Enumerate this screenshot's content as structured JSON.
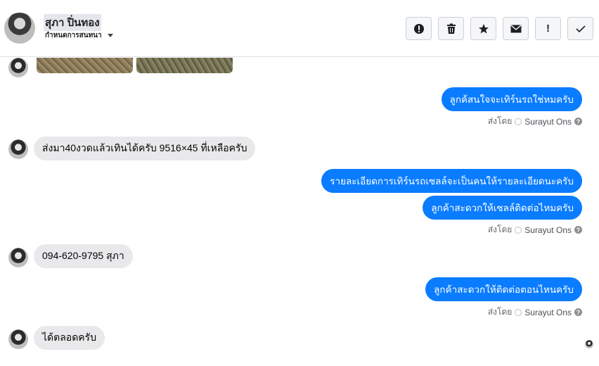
{
  "header": {
    "name": "สุภา ปิ่นทอง",
    "subtitle": "กำหนดการสนทนา",
    "actions": [
      {
        "icon": "alert-circle-icon"
      },
      {
        "icon": "trash-icon"
      },
      {
        "icon": "star-icon"
      },
      {
        "icon": "mail-icon"
      },
      {
        "icon": "exclamation-icon",
        "label": "!"
      },
      {
        "icon": "checkmark-icon"
      }
    ]
  },
  "messages": {
    "out1": "ลูกค้สนใจจะเทิร์นรถใช่หมครับ",
    "in1": "ส่งมา40งวดแล้วเทินได้ครับ 9516×45 ที่เหลือครับ",
    "out2": "รายละเอียดการเทิร์นรถเซลล์จะเป็นคนให้รายละเอียดนะครับ",
    "out3": "ลูกค้าสะดวกให้เซลล์ติดต่อไหมครับ",
    "in2": "094-620-9795 สุภา",
    "out4": "ลูกค้าสะดวกให้ติดต่อตอนไหนครับ",
    "in3": "ได้ตลอดครับ"
  },
  "sent_by": {
    "prefix": "ส่งโดย",
    "name": "Surayut Ons",
    "help": "?"
  },
  "colors": {
    "outgoing_bubble": "#0a7cff",
    "incoming_bubble": "#e9e9eb"
  }
}
